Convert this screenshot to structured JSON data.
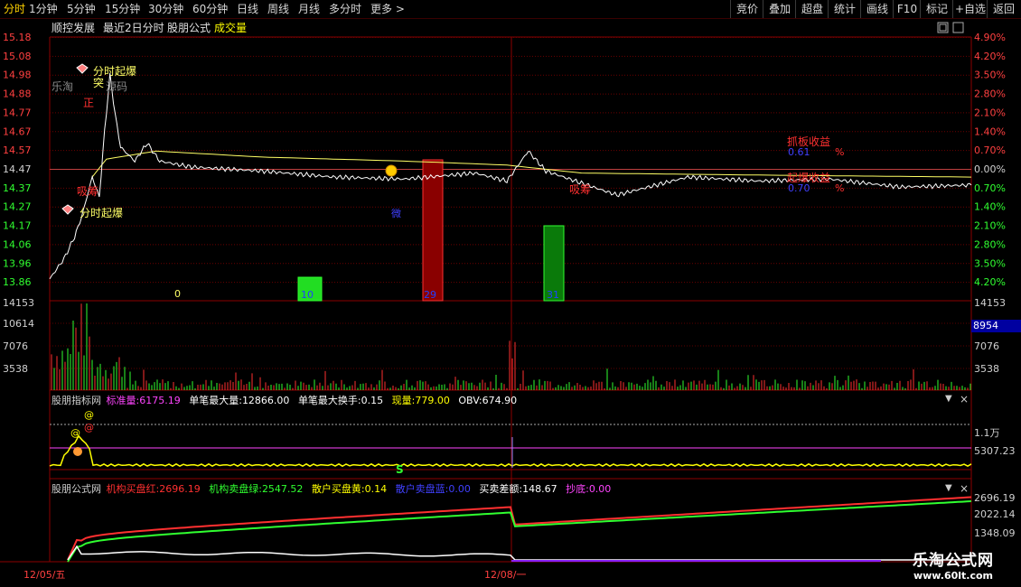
{
  "toolbar": {
    "periods": [
      "分时",
      "1分钟",
      "5分钟",
      "15分钟",
      "30分钟",
      "60分钟",
      "日线",
      "周线",
      "月线",
      "多分时",
      "更多 >"
    ],
    "right_buttons": [
      "竞价",
      "叠加",
      "超盘",
      "统计",
      "画线",
      "F10",
      "标记",
      "+自选",
      "返回"
    ]
  },
  "subtitle": {
    "stock": "顺控发展",
    "mode": "最近2日分时",
    "formula": "股朋公式",
    "volume": "成交量"
  },
  "price_axis": {
    "left": [
      "15.18",
      "15.08",
      "14.98",
      "14.88",
      "14.77",
      "14.67",
      "14.57",
      "14.47",
      "14.37",
      "14.27",
      "14.17",
      "14.06",
      "13.96",
      "13.86"
    ],
    "right": [
      "4.90%",
      "4.20%",
      "3.50%",
      "2.80%",
      "2.10%",
      "1.40%",
      "0.70%",
      "0.00%",
      "0.70%",
      "1.40%",
      "2.10%",
      "2.80%",
      "3.50%",
      "4.20%"
    ]
  },
  "volume_axis": {
    "left": [
      "14153",
      "10614",
      "7076",
      "3538"
    ],
    "right": [
      "7076",
      "3538"
    ],
    "current": "8954"
  },
  "annotations": {
    "burst1": "分时起爆",
    "burst2": "分时起爆",
    "breakout": "突",
    "watermark_small": "乐淘",
    "watermark_src": "源码",
    "zheng": "正",
    "xichou1": "吸筹",
    "xichou2": "吸筹",
    "num0": "0",
    "num1": "10",
    "num2": "29",
    "num3": "31",
    "mark": "微",
    "profit_label1": "抓板收益",
    "profit_val1": "0.61",
    "pct1": "%",
    "profit_label2": "起爆收益",
    "profit_val2": "0.70",
    "pct2": "%"
  },
  "indicator1": {
    "name": "股朋指标网",
    "items": [
      {
        "label": "标准量:",
        "value": "6175.19",
        "color": "#ff44ff"
      },
      {
        "label": "单笔最大量:",
        "value": "12866.00",
        "color": "#ffffff"
      },
      {
        "label": "单笔最大换手:",
        "value": "0.15",
        "color": "#ffffff"
      },
      {
        "label": "现量:",
        "value": "779.00",
        "color": "#ffff00"
      },
      {
        "label": "OBV:",
        "value": "674.90",
        "color": "#ffffff"
      }
    ],
    "axis": [
      "1.1万",
      "5307.23"
    ],
    "at_marks": [
      "@",
      "@",
      "@"
    ],
    "s_mark": "S"
  },
  "indicator2": {
    "name": "股朋公式网",
    "items": [
      {
        "label": "机构买盘红:",
        "value": "2696.19",
        "color": "#ff3030"
      },
      {
        "label": "机构卖盘绿:",
        "value": "2547.52",
        "color": "#30ff30"
      },
      {
        "label": "散户买盘黄:",
        "value": "0.14",
        "color": "#ffff00"
      },
      {
        "label": "散户卖盘蓝:",
        "value": "0.00",
        "color": "#3030ff"
      },
      {
        "label": "买卖差额:",
        "value": "148.67",
        "color": "#ffffff"
      },
      {
        "label": "抄底:",
        "value": "0.00",
        "color": "#ff44ff"
      }
    ],
    "axis": [
      "2696.19",
      "2022.14",
      "1348.09"
    ]
  },
  "dates": [
    "12/05/五",
    "12/08/一"
  ],
  "watermark": {
    "line1": "乐淘公式网",
    "line2": "www.60lt.com"
  },
  "chart_data": {
    "type": "line",
    "title": "顺控发展 最近2日分时",
    "days": [
      "12/05/五",
      "12/08/一"
    ],
    "reference_close": 14.47,
    "price_range": [
      13.86,
      15.18
    ],
    "price_series": [
      {
        "t": 0,
        "price": 13.96
      },
      {
        "t": 8,
        "price": 14.06
      },
      {
        "t": 14,
        "price": 14.17
      },
      {
        "t": 18,
        "price": 14.27
      },
      {
        "t": 24,
        "price": 14.47
      },
      {
        "t": 28,
        "price": 14.37
      },
      {
        "t": 31,
        "price": 14.7
      },
      {
        "t": 34,
        "price": 14.98
      },
      {
        "t": 37,
        "price": 14.78
      },
      {
        "t": 40,
        "price": 14.62
      },
      {
        "t": 48,
        "price": 14.55
      },
      {
        "t": 55,
        "price": 14.64
      },
      {
        "t": 62,
        "price": 14.55
      },
      {
        "t": 80,
        "price": 14.52
      },
      {
        "t": 120,
        "price": 14.5
      },
      {
        "t": 160,
        "price": 14.47
      },
      {
        "t": 200,
        "price": 14.46
      },
      {
        "t": 240,
        "price": 14.49
      },
      {
        "t": 258,
        "price": 14.45
      },
      {
        "t": 270,
        "price": 14.6
      },
      {
        "t": 280,
        "price": 14.5
      },
      {
        "t": 300,
        "price": 14.44
      },
      {
        "t": 320,
        "price": 14.38
      },
      {
        "t": 360,
        "price": 14.47
      },
      {
        "t": 400,
        "price": 14.45
      },
      {
        "t": 440,
        "price": 14.46
      },
      {
        "t": 480,
        "price": 14.42
      },
      {
        "t": 520,
        "price": 14.43
      }
    ],
    "avg_series": [
      {
        "t": 24,
        "price": 14.47
      },
      {
        "t": 32,
        "price": 14.56
      },
      {
        "t": 60,
        "price": 14.6
      },
      {
        "t": 120,
        "price": 14.57
      },
      {
        "t": 200,
        "price": 14.55
      },
      {
        "t": 258,
        "price": 14.53
      },
      {
        "t": 300,
        "price": 14.49
      },
      {
        "t": 400,
        "price": 14.48
      },
      {
        "t": 520,
        "price": 14.47
      }
    ],
    "bars": [
      {
        "label": "10",
        "value": 10,
        "color": "#22dd22"
      },
      {
        "label": "29",
        "value": 29,
        "color": "#8a0000"
      },
      {
        "label": "31",
        "value": 31,
        "color": "#0a7a0a"
      }
    ]
  }
}
